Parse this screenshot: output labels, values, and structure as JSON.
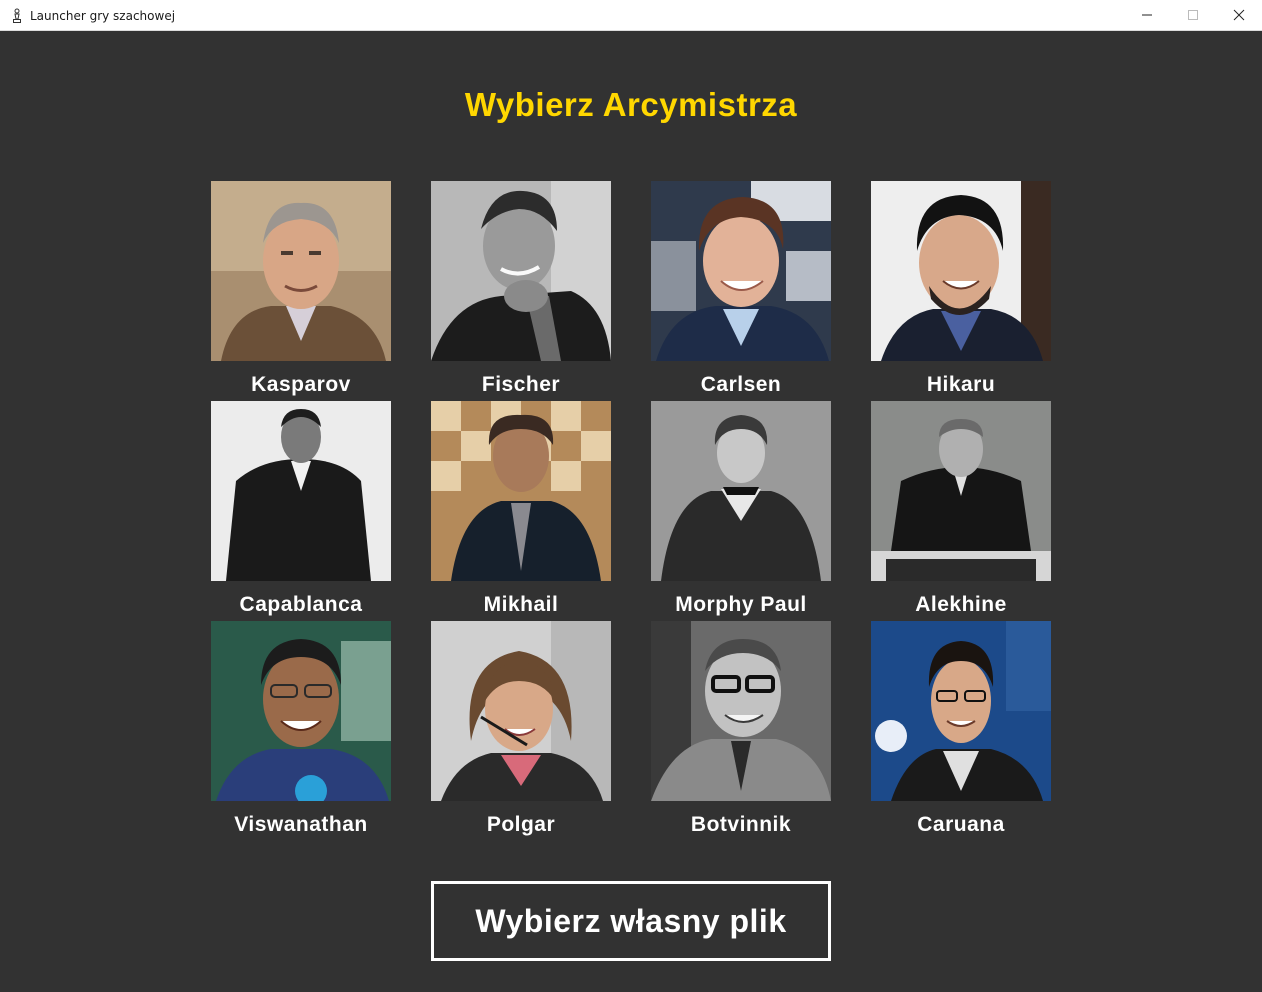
{
  "window": {
    "title": "Launcher gry szachowej",
    "icon": "chess-pawn-icon",
    "controls": [
      "minimize-icon",
      "maximize-icon",
      "close-icon"
    ]
  },
  "heading": "Wybierz Arcymistrza",
  "accent_color": "#ffd700",
  "background_color": "#323232",
  "grandmasters": [
    {
      "name": "Kasparov",
      "photo": "color"
    },
    {
      "name": "Fischer",
      "photo": "black-and-white"
    },
    {
      "name": "Carlsen",
      "photo": "color"
    },
    {
      "name": "Hikaru",
      "photo": "color"
    },
    {
      "name": "Capablanca",
      "photo": "black-and-white"
    },
    {
      "name": "Mikhail",
      "photo": "color"
    },
    {
      "name": "Morphy Paul",
      "photo": "black-and-white"
    },
    {
      "name": "Alekhine",
      "photo": "black-and-white"
    },
    {
      "name": "Viswanathan",
      "photo": "color"
    },
    {
      "name": "Polgar",
      "photo": "color"
    },
    {
      "name": "Botvinnik",
      "photo": "black-and-white"
    },
    {
      "name": "Caruana",
      "photo": "color"
    }
  ],
  "own_file_button": "Wybierz własny plik"
}
